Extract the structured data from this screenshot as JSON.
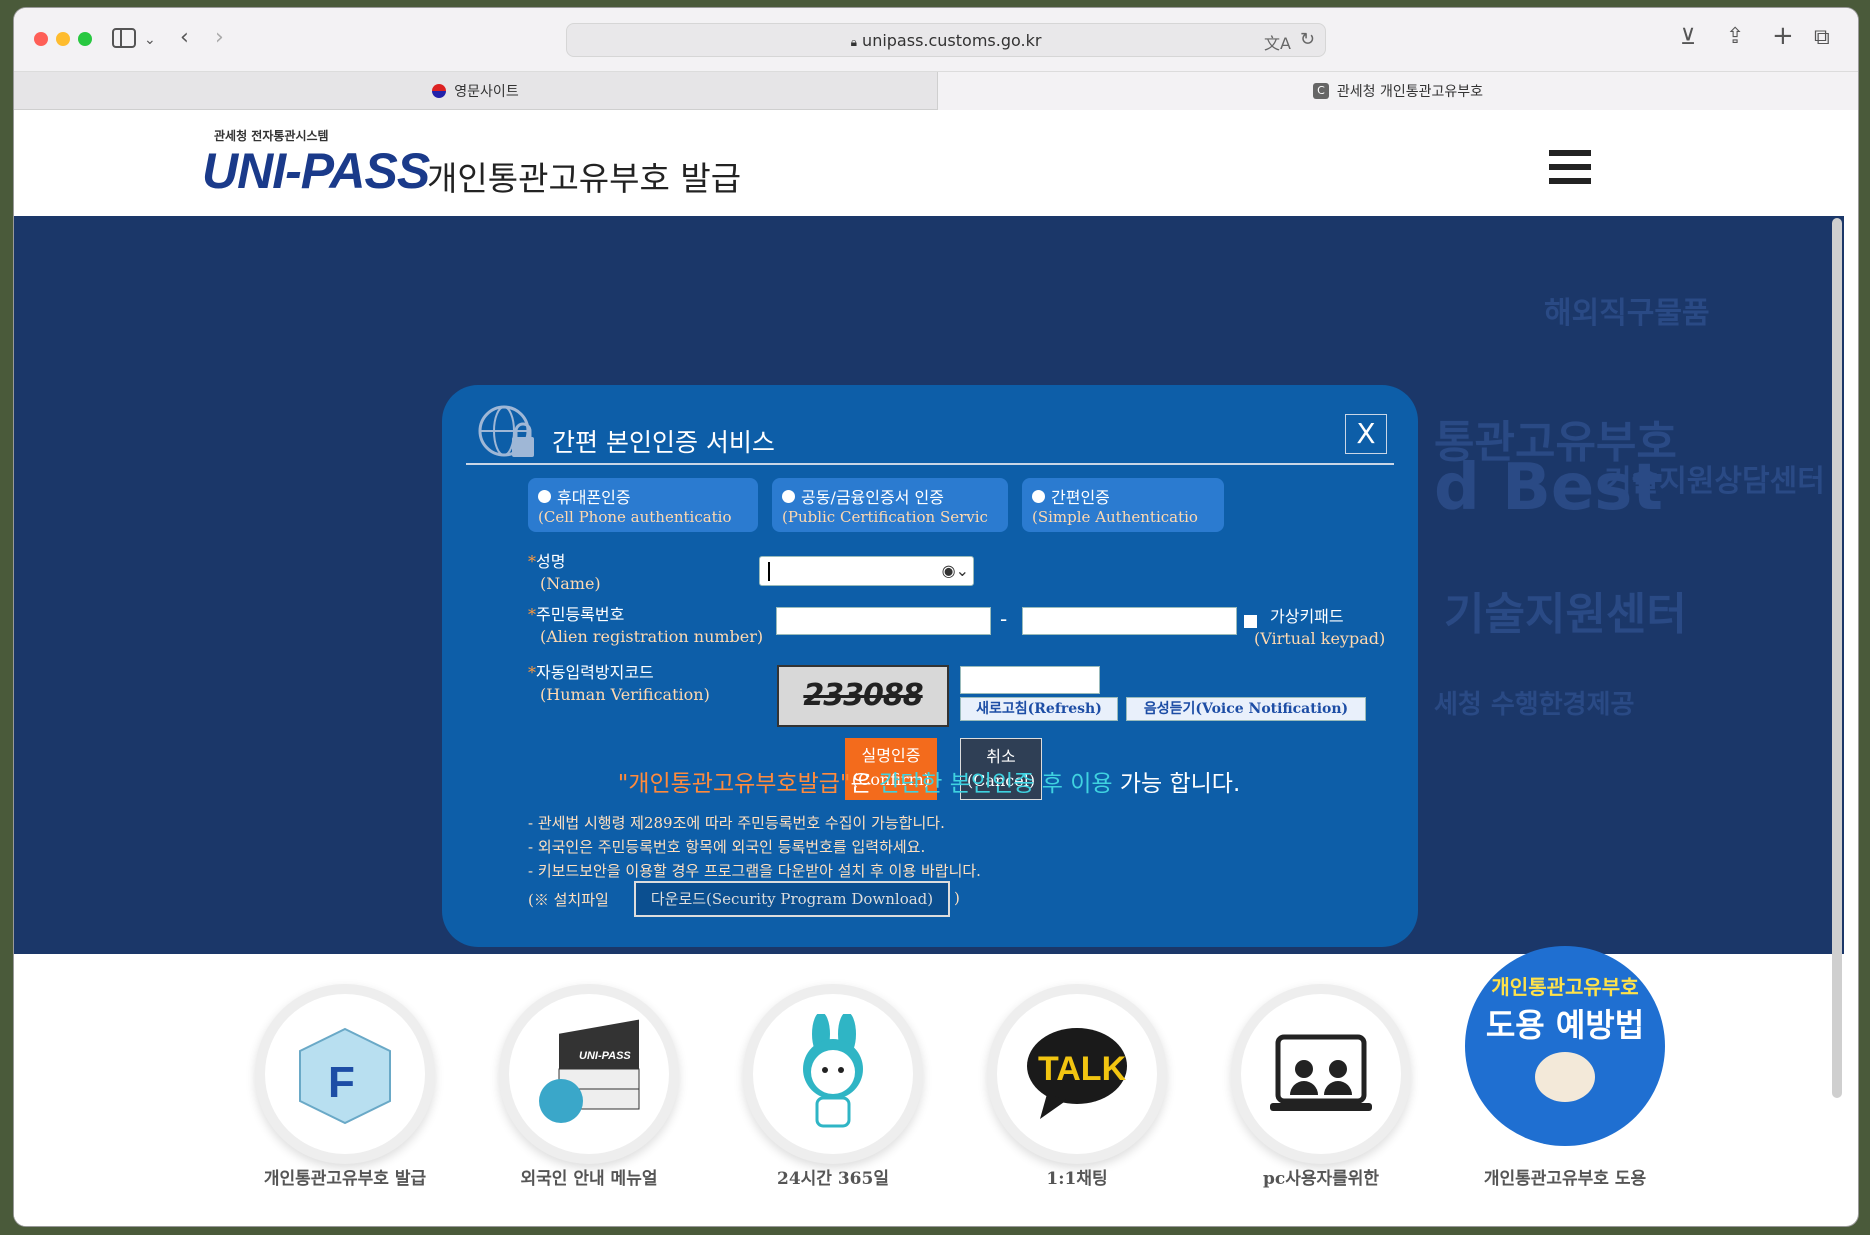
{
  "browser": {
    "url": "unipass.customs.go.kr",
    "tabs": [
      {
        "label": "영문사이트"
      },
      {
        "label": "관세청 개인통관고유부호"
      }
    ]
  },
  "header": {
    "logo_small": "관세청 전자통관시스템",
    "logo": "UNI-PASS",
    "title": "개인통관고유부호 발급"
  },
  "banner": {
    "cloud_words": [
      "해외직구물품",
      "통관고유부호",
      "기술지원상담센터",
      "d Best",
      "기술지원센터",
      "세청 수행한경제공"
    ],
    "message_quote": "\"개인통관고유부호발급\"",
    "message_mid": "은 ",
    "message_highlight": "간단한 본인인증 후 이용",
    "message_end": " 가능 합니다.",
    "colors": {
      "quote": "#ff8a3c",
      "highlight": "#3fd2e0",
      "banner_bg": "#1b3769"
    }
  },
  "modal": {
    "title": "간편 본인인증 서비스",
    "close_label": "X",
    "options": [
      {
        "ko": "휴대폰인증",
        "en": "(Cell Phone authenticatio"
      },
      {
        "ko": "공동/금융인증서 인증",
        "en": "(Public Certification Servic"
      },
      {
        "ko": "간편인증",
        "en": "(Simple Authenticatio"
      }
    ],
    "fields": {
      "name_ko": "성명",
      "name_en": "(Name)",
      "reg_ko": "주민등록번호",
      "reg_en": "(Alien registration number)",
      "dash": "-",
      "vk_ko": "가상키패드",
      "vk_en": "(Virtual keypad)",
      "captcha_ko": "자동입력방지코드",
      "captcha_en": "(Human Verification)",
      "captcha_text": "233088"
    },
    "buttons": {
      "refresh": "새로고침(Refresh)",
      "voice": "음성듣기(Voice Notification)",
      "confirm_ko": "실명인증",
      "confirm_en": "(Confirm)",
      "cancel_ko": "취소",
      "cancel_en": "(Cancel)"
    },
    "notes": [
      "- 관세법 시행령 제289조에 따라 주민등록번호 수집이 가능합니다.",
      "- 외국인은 주민등록번호 항목에 외국인 등록번호를 입력하세요.",
      "- 키보드보안을 이용할 경우 프로그램을 다운받아 설치 후 이용 바랍니다."
    ],
    "install_prefix": "(※ 설치파일",
    "download_label": "다운로드(Security Program Download)",
    "install_suffix": ")",
    "colors": {
      "modal_bg": "#0d5ea8",
      "confirm": "#f36b1c",
      "cancel": "#2f3f55"
    }
  },
  "quick_links": [
    {
      "label": "개인통관고유부호 발급",
      "icon": "f-cube-icon"
    },
    {
      "label": "외국인 안내 메뉴얼",
      "icon": "unipass-books-icon"
    },
    {
      "label": "24시간 365일",
      "icon": "mascot-icon"
    },
    {
      "label": "1:1채팅",
      "icon": "talk-bubble-icon"
    },
    {
      "label": "pc사용자를위한",
      "icon": "monitor-users-icon"
    },
    {
      "label": "개인통관고유부호 도용",
      "icon": "misuse-prevention-icon",
      "badge_line1": "개인통관고유부호",
      "badge_line2": "도용 예방법"
    }
  ]
}
